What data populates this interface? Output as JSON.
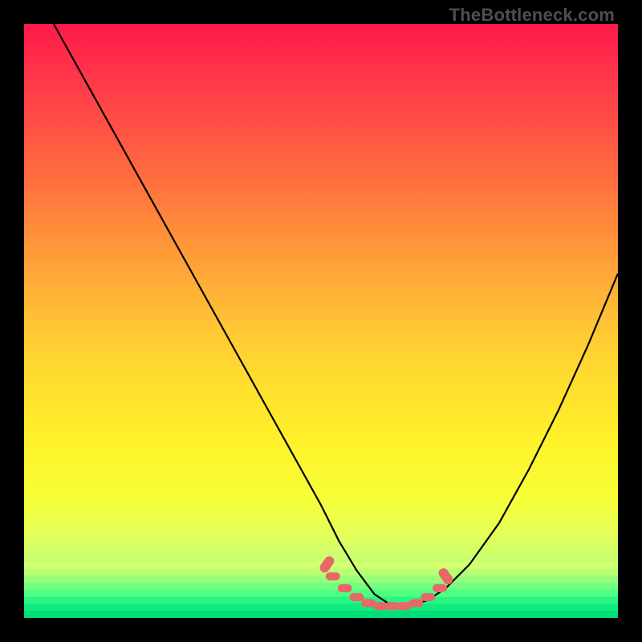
{
  "watermark": "TheBottleneck.com",
  "colors": {
    "frame_bg": "#000000",
    "curve": "#000000",
    "marker": "#e86767",
    "gradient_stops": [
      {
        "offset": 0.0,
        "color": "#ff1a4b"
      },
      {
        "offset": 0.1,
        "color": "#ff3a4a"
      },
      {
        "offset": 0.25,
        "color": "#ff6a3f"
      },
      {
        "offset": 0.4,
        "color": "#ffa038"
      },
      {
        "offset": 0.55,
        "color": "#ffd232"
      },
      {
        "offset": 0.7,
        "color": "#fff12a"
      },
      {
        "offset": 0.8,
        "color": "#f6ff38"
      },
      {
        "offset": 0.86,
        "color": "#e4ff5a"
      },
      {
        "offset": 0.9,
        "color": "#c8ff70"
      },
      {
        "offset": 0.94,
        "color": "#92ff80"
      },
      {
        "offset": 0.97,
        "color": "#4cff86"
      },
      {
        "offset": 1.0,
        "color": "#00e67a"
      }
    ]
  },
  "chart_data": {
    "type": "line",
    "title": "",
    "xlabel": "",
    "ylabel": "",
    "xlim": [
      0,
      100
    ],
    "ylim": [
      0,
      100
    ],
    "grid": false,
    "legend": false,
    "description": "Bottleneck-style V-curve. Background is a red→yellow→green vertical gradient. A single black line starts near top-left, descends steeply, flattens near the bottom around x≈62, then rises. Coral dotted markers highlight the flat valley region.",
    "series": [
      {
        "name": "bottleneck-curve",
        "x": [
          5,
          10,
          15,
          20,
          25,
          30,
          35,
          40,
          45,
          50,
          53,
          56,
          59,
          62,
          65,
          68,
          71,
          75,
          80,
          85,
          90,
          95,
          100
        ],
        "y": [
          100,
          91,
          82,
          73,
          64,
          55,
          46,
          37,
          28,
          19,
          13,
          8,
          4,
          2,
          2,
          3,
          5,
          9,
          16,
          25,
          35,
          46,
          58
        ]
      }
    ],
    "markers": {
      "name": "valley-highlight",
      "x": [
        52,
        54,
        56,
        58,
        60,
        62,
        64,
        66,
        68,
        70
      ],
      "y": [
        7,
        5,
        3.5,
        2.5,
        2,
        2,
        2,
        2.5,
        3.5,
        5
      ]
    }
  }
}
